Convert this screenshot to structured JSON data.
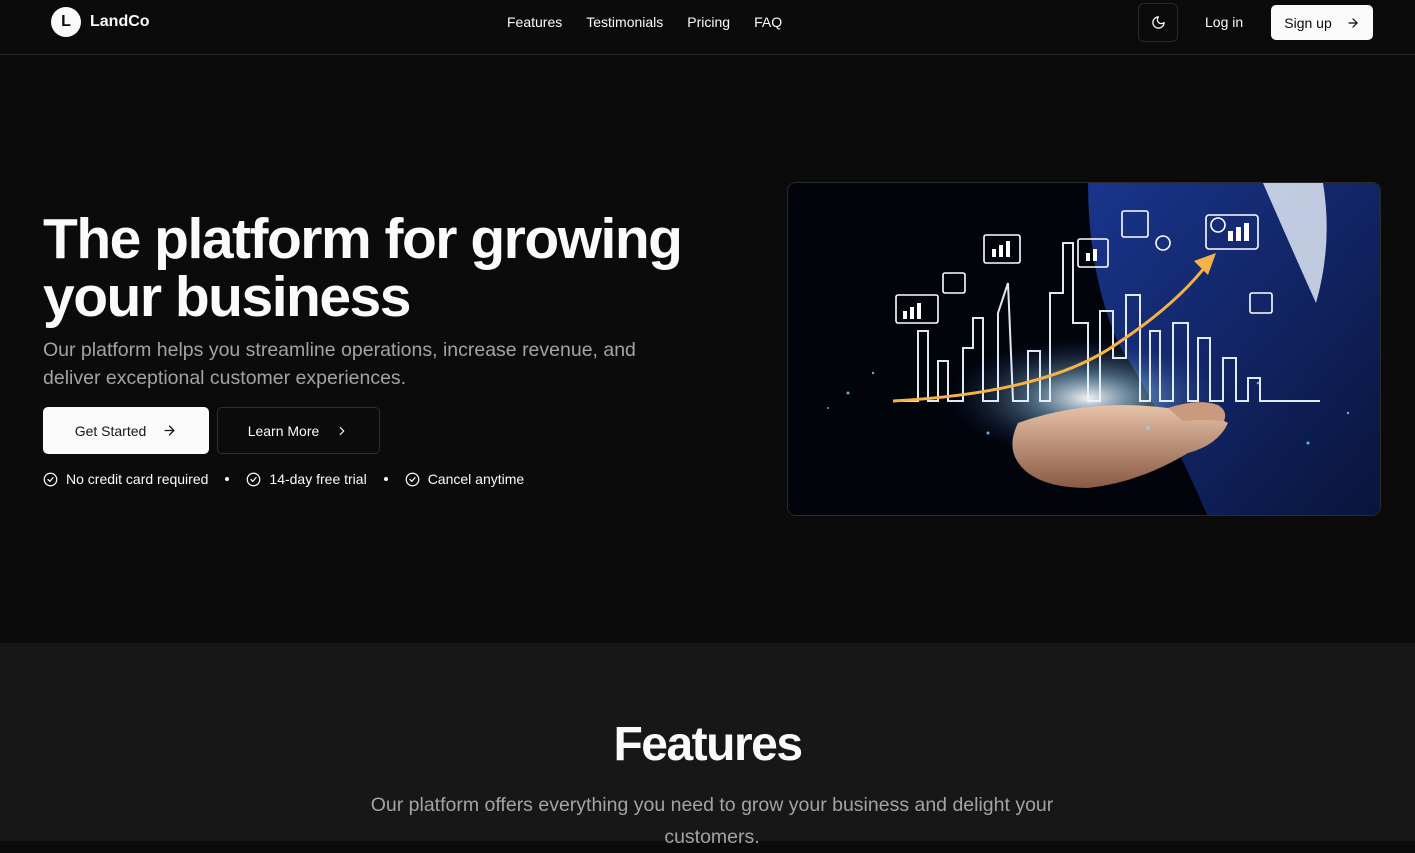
{
  "brand": {
    "logo_letter": "L",
    "name": "LandCo"
  },
  "nav": {
    "items": [
      "Features",
      "Testimonials",
      "Pricing",
      "FAQ"
    ]
  },
  "header": {
    "theme_toggle_icon": "moon-icon",
    "login_label": "Log in",
    "signup_label": "Sign up"
  },
  "hero": {
    "title": "The platform for growing your business",
    "subtitle": "Our platform helps you streamline operations, increase revenue, and deliver exceptional customer experiences.",
    "primary_cta": "Get Started",
    "secondary_cta": "Learn More",
    "perks": [
      "No credit card required",
      "14-day free trial",
      "Cancel anytime"
    ],
    "image_subject": "hand-holding-glowing-growth-chart"
  },
  "features": {
    "title": "Features",
    "subtitle": "Our platform offers everything you need to grow your business and delight your customers."
  },
  "colors": {
    "background": "#0b0b0b",
    "section_alt": "#171717",
    "text": "#fafafa",
    "muted": "#a3a3a3",
    "accent_glow": "#f5b347",
    "image_blue": "#1e3b8a"
  }
}
